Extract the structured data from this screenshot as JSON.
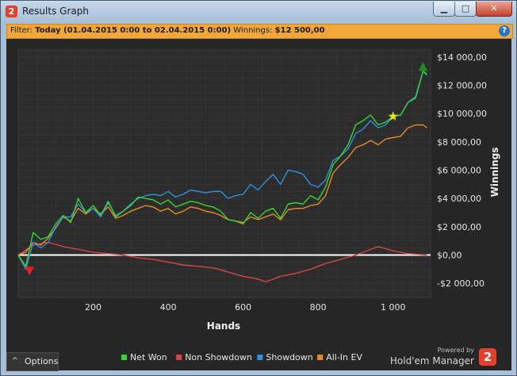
{
  "window": {
    "title": "Results Graph",
    "app_icon_glyph": "2",
    "min_glyph": "▁",
    "max_glyph": "□",
    "close_glyph": "✕"
  },
  "filter": {
    "label": "Filter:",
    "range": "Today (01.04.2015 0:00 to 02.04.2015 0:00)",
    "winnings_label": "Winnings:",
    "winnings_value": "$12 500,00",
    "help_glyph": "?"
  },
  "options": {
    "label": "Options",
    "caret": "^"
  },
  "branding": {
    "powered_by": "Powered by",
    "name": "Hold'em Manager",
    "logo_glyph": "2"
  },
  "colors": {
    "net_won": "#38d430",
    "non_showdown": "#d64545",
    "showdown": "#2f8fe0",
    "all_in_ev": "#e8892a",
    "zero_line": "#ffffff",
    "background": "#262626",
    "grid": "#3a3a3a"
  },
  "chart_data": {
    "type": "line",
    "xlabel": "Hands",
    "ylabel": "Winnings",
    "xlim": [
      0,
      1100
    ],
    "ylim": [
      -3000,
      14500
    ],
    "x_ticks": [
      200,
      400,
      600,
      800,
      1000
    ],
    "x_tick_labels": [
      "200",
      "400",
      "600",
      "800",
      "1 000"
    ],
    "y_ticks": [
      -2000,
      0,
      2000,
      4000,
      6000,
      8000,
      10000,
      12000,
      14000
    ],
    "y_tick_labels": [
      "-$2 000,00",
      "$0,00",
      "$2 000,00",
      "$4 000,00",
      "$6 000,00",
      "$8 000,00",
      "$10 000,00",
      "$12 000,00",
      "$14 000,00"
    ],
    "legend_position": "bottom",
    "series": [
      {
        "name": "Net Won",
        "color": "#38d430",
        "x": [
          0,
          20,
          40,
          60,
          80,
          100,
          120,
          140,
          160,
          180,
          200,
          220,
          240,
          260,
          280,
          300,
          320,
          340,
          360,
          380,
          400,
          420,
          440,
          460,
          480,
          500,
          520,
          540,
          560,
          580,
          600,
          620,
          640,
          660,
          680,
          700,
          720,
          740,
          760,
          780,
          800,
          820,
          840,
          860,
          880,
          900,
          920,
          940,
          960,
          980,
          1000,
          1020,
          1040,
          1060,
          1080,
          1090
        ],
        "y": [
          0,
          -800,
          1600,
          1100,
          1300,
          2200,
          2800,
          2300,
          4000,
          3000,
          3500,
          2800,
          3800,
          2700,
          3100,
          3500,
          4100,
          4000,
          3900,
          3600,
          3900,
          3400,
          3600,
          3800,
          3700,
          3500,
          3400,
          3100,
          2500,
          2400,
          2200,
          3000,
          2600,
          3100,
          3300,
          2600,
          3600,
          3700,
          3600,
          4200,
          3900,
          4800,
          6400,
          7000,
          7800,
          9200,
          9500,
          9900,
          9200,
          9400,
          9800,
          9900,
          10800,
          11100,
          13000,
          12800
        ]
      },
      {
        "name": "Non Showdown",
        "color": "#d64545",
        "x": [
          0,
          40,
          80,
          120,
          160,
          200,
          240,
          280,
          320,
          360,
          400,
          440,
          480,
          520,
          560,
          600,
          640,
          660,
          700,
          740,
          780,
          820,
          860,
          900,
          940,
          960,
          1000,
          1040,
          1090
        ],
        "y": [
          0,
          700,
          900,
          600,
          400,
          200,
          100,
          0,
          -200,
          -300,
          -500,
          -700,
          -800,
          -900,
          -1200,
          -1500,
          -1700,
          -1900,
          -1500,
          -1300,
          -1000,
          -600,
          -300,
          0,
          400,
          600,
          300,
          100,
          0
        ]
      },
      {
        "name": "Showdown",
        "color": "#2f8fe0",
        "x": [
          0,
          20,
          40,
          60,
          80,
          100,
          120,
          140,
          160,
          180,
          200,
          220,
          240,
          260,
          280,
          300,
          320,
          340,
          360,
          380,
          400,
          420,
          440,
          460,
          480,
          500,
          520,
          540,
          560,
          580,
          600,
          620,
          640,
          660,
          680,
          700,
          720,
          740,
          760,
          780,
          800,
          820,
          840,
          860,
          880,
          900,
          920,
          940,
          960,
          980,
          1000,
          1020,
          1040,
          1060,
          1080,
          1090
        ],
        "y": [
          0,
          -1000,
          900,
          500,
          900,
          2000,
          2700,
          2700,
          3600,
          3000,
          3300,
          2700,
          3700,
          2800,
          3100,
          3600,
          4000,
          4200,
          4300,
          4200,
          4500,
          4100,
          4300,
          4600,
          4500,
          4400,
          4500,
          4500,
          4000,
          4200,
          4300,
          5000,
          4600,
          5200,
          5700,
          5000,
          6000,
          5900,
          5700,
          5000,
          4800,
          5300,
          6700,
          7000,
          7500,
          8600,
          8900,
          9500,
          9000,
          9200,
          9800,
          9900,
          10800,
          11200,
          13000,
          12700
        ]
      },
      {
        "name": "All-In EV",
        "color": "#e8892a",
        "x": [
          0,
          20,
          40,
          60,
          80,
          100,
          120,
          140,
          160,
          180,
          200,
          220,
          240,
          260,
          280,
          300,
          320,
          340,
          360,
          380,
          400,
          420,
          440,
          460,
          480,
          500,
          520,
          540,
          560,
          580,
          600,
          620,
          640,
          660,
          680,
          700,
          720,
          740,
          760,
          780,
          800,
          820,
          840,
          860,
          880,
          900,
          920,
          940,
          960,
          980,
          1000,
          1020,
          1040,
          1060,
          1080,
          1090
        ],
        "y": [
          0,
          200,
          900,
          700,
          1200,
          1900,
          2700,
          2400,
          3300,
          2900,
          3300,
          2900,
          3400,
          2600,
          2800,
          3100,
          3300,
          3500,
          3400,
          3100,
          3300,
          2900,
          3100,
          3400,
          3300,
          3100,
          3000,
          2800,
          2500,
          2400,
          2300,
          2700,
          2500,
          2700,
          2900,
          2500,
          3200,
          3300,
          3300,
          3500,
          3600,
          4200,
          5800,
          6400,
          6900,
          7600,
          7800,
          8100,
          7800,
          8200,
          8300,
          8400,
          9000,
          9200,
          9200,
          9000
        ]
      }
    ],
    "markers": [
      {
        "type": "min",
        "x": 30,
        "y": -1100,
        "color": "#e02020"
      },
      {
        "type": "max",
        "x": 1080,
        "y": 13300,
        "color": "#1e8a1e"
      },
      {
        "type": "star",
        "x": 1000,
        "y": 9800,
        "color": "#f5e618"
      }
    ]
  }
}
